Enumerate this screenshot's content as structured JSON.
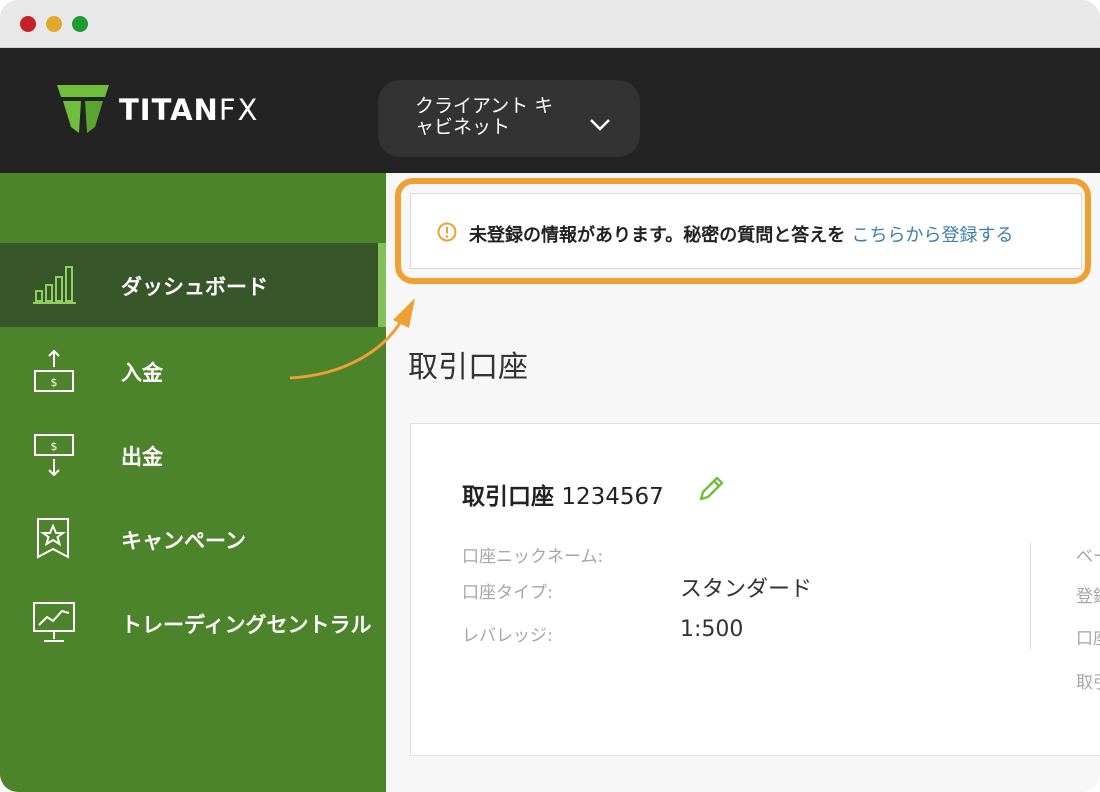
{
  "header": {
    "logo_main": "TITAN",
    "logo_fx": "FX",
    "cabinet_label": "クライアント キャビネット"
  },
  "sidebar": {
    "items": [
      {
        "label": "ダッシュボード",
        "icon": "bar-chart-icon",
        "active": true
      },
      {
        "label": "入金",
        "icon": "deposit-icon"
      },
      {
        "label": "出金",
        "icon": "withdraw-icon"
      },
      {
        "label": "キャンペーン",
        "icon": "campaign-badge-icon"
      },
      {
        "label": "トレーディングセントラル",
        "icon": "trading-monitor-icon"
      }
    ]
  },
  "alert": {
    "text": "未登録の情報があります。秘密の質問と答えを ",
    "link": "こちらから登録する",
    "icon": "warning-icon",
    "highlight_color": "#f0a032"
  },
  "main": {
    "title": "取引口座"
  },
  "account": {
    "title_label": "取引口座",
    "number": "1234567",
    "fields": [
      {
        "label": "口座ニックネーム:",
        "value": ""
      },
      {
        "label": "口座タイプ:",
        "value": "スタンダード"
      },
      {
        "label": "レバレッジ:",
        "value": "1:500"
      }
    ],
    "right_labels": [
      "ベー",
      "登録",
      "口座",
      "取引"
    ]
  },
  "colors": {
    "sidebar": "#4d842b",
    "sidebar_active": "#37572a",
    "topbar": "#232323",
    "link": "#3f7fb0"
  }
}
